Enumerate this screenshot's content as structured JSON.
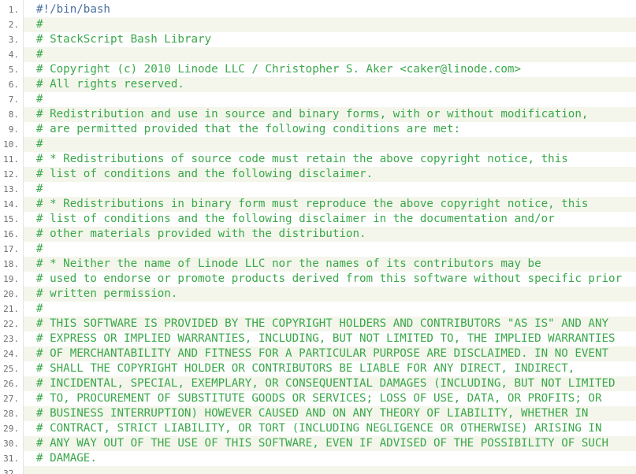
{
  "editor": {
    "lines": [
      {
        "number": "1.",
        "text": "#!/bin/bash"
      },
      {
        "number": "2.",
        "text": "#"
      },
      {
        "number": "3.",
        "text": "# StackScript Bash Library"
      },
      {
        "number": "4.",
        "text": "#"
      },
      {
        "number": "5.",
        "text": "# Copyright (c) 2010 Linode LLC / Christopher S. Aker <caker@linode.com>"
      },
      {
        "number": "6.",
        "text": "# All rights reserved."
      },
      {
        "number": "7.",
        "text": "#"
      },
      {
        "number": "8.",
        "text": "# Redistribution and use in source and binary forms, with or without modification,"
      },
      {
        "number": "9.",
        "text": "# are permitted provided that the following conditions are met:"
      },
      {
        "number": "10.",
        "text": "#"
      },
      {
        "number": "11.",
        "text": "# * Redistributions of source code must retain the above copyright notice, this"
      },
      {
        "number": "12.",
        "text": "# list of conditions and the following disclaimer."
      },
      {
        "number": "13.",
        "text": "#"
      },
      {
        "number": "14.",
        "text": "# * Redistributions in binary form must reproduce the above copyright notice, this"
      },
      {
        "number": "15.",
        "text": "# list of conditions and the following disclaimer in the documentation and/or"
      },
      {
        "number": "16.",
        "text": "# other materials provided with the distribution."
      },
      {
        "number": "17.",
        "text": "#"
      },
      {
        "number": "18.",
        "text": "# * Neither the name of Linode LLC nor the names of its contributors may be"
      },
      {
        "number": "19.",
        "text": "# used to endorse or promote products derived from this software without specific prior"
      },
      {
        "number": "20.",
        "text": "# written permission."
      },
      {
        "number": "21.",
        "text": "#"
      },
      {
        "number": "22.",
        "text": "# THIS SOFTWARE IS PROVIDED BY THE COPYRIGHT HOLDERS AND CONTRIBUTORS \"AS IS\" AND ANY"
      },
      {
        "number": "23.",
        "text": "# EXPRESS OR IMPLIED WARRANTIES, INCLUDING, BUT NOT LIMITED TO, THE IMPLIED WARRANTIES"
      },
      {
        "number": "24.",
        "text": "# OF MERCHANTABILITY AND FITNESS FOR A PARTICULAR PURPOSE ARE DISCLAIMED. IN NO EVENT"
      },
      {
        "number": "25.",
        "text": "# SHALL THE COPYRIGHT HOLDER OR CONTRIBUTORS BE LIABLE FOR ANY DIRECT, INDIRECT,"
      },
      {
        "number": "26.",
        "text": "# INCIDENTAL, SPECIAL, EXEMPLARY, OR CONSEQUENTIAL DAMAGES (INCLUDING, BUT NOT LIMITED"
      },
      {
        "number": "27.",
        "text": "# TO, PROCUREMENT OF SUBSTITUTE GOODS OR SERVICES; LOSS OF USE, DATA, OR PROFITS; OR"
      },
      {
        "number": "28.",
        "text": "# BUSINESS INTERRUPTION) HOWEVER CAUSED AND ON ANY THEORY OF LIABILITY, WHETHER IN"
      },
      {
        "number": "29.",
        "text": "# CONTRACT, STRICT LIABILITY, OR TORT (INCLUDING NEGLIGENCE OR OTHERWISE) ARISING IN"
      },
      {
        "number": "30.",
        "text": "# ANY WAY OUT OF THE USE OF THIS SOFTWARE, EVEN IF ADVISED OF THE POSSIBILITY OF SUCH"
      },
      {
        "number": "31.",
        "text": "# DAMAGE."
      },
      {
        "number": "32.",
        "text": ""
      }
    ]
  },
  "colors": {
    "comment": "#3aa84a",
    "shebang": "#4a6fa0",
    "line_number": "#6d6d6d",
    "alt_row_background": "#f4f6ec"
  }
}
